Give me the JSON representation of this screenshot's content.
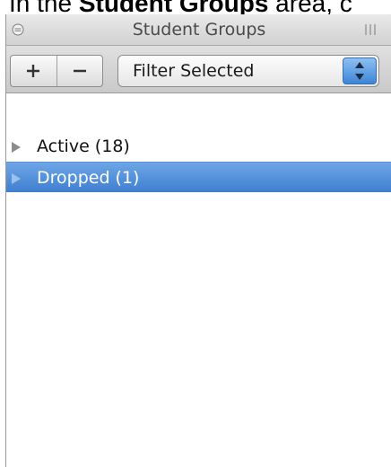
{
  "caption": {
    "prefix": "In the ",
    "bold": "Student Groups",
    "suffix": " area, c"
  },
  "panel": {
    "title": "Student Groups"
  },
  "toolbar": {
    "add_label": "+",
    "remove_label": "−",
    "filter_value": "Filter Selected"
  },
  "groups": [
    {
      "label": "Active (18)",
      "selected": false
    },
    {
      "label": "Dropped (1)",
      "selected": true
    }
  ],
  "colors": {
    "selection": "#4a8ad8",
    "titlebar": "#dcdcdc"
  },
  "icons": {
    "collapse": "collapse-circle-icon",
    "grip": "resize-grip-icon",
    "stepper": "up-down-stepper-icon",
    "disclosure": "disclosure-triangle-icon"
  }
}
